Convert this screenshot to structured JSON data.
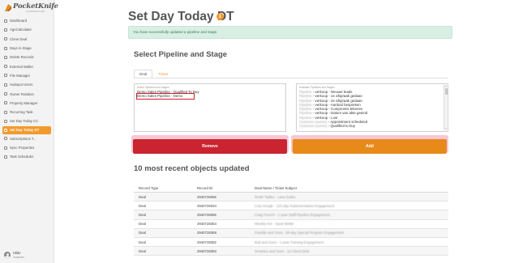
{
  "app": {
    "logo_text": "PocketKnife",
    "logo_subtext": "by CONTRAST ORG"
  },
  "sidebar": {
    "items": [
      {
        "label": "Dashboard",
        "icon": "dashboard-icon"
      },
      {
        "label": "AgeCalculator",
        "icon": "calculator-icon"
      },
      {
        "label": "Clone Deal",
        "icon": "clone-icon"
      },
      {
        "label": "Days in Stage",
        "icon": "calendar-icon"
      },
      {
        "label": "Delete Records",
        "icon": "trash-icon"
      },
      {
        "label": "External Wallet",
        "icon": "wallet-icon"
      },
      {
        "label": "File Manager",
        "icon": "folder-icon"
      },
      {
        "label": "Hubspot Users",
        "icon": "users-icon"
      },
      {
        "label": "Owner Rotation",
        "icon": "rotation-icon"
      },
      {
        "label": "Property Manager",
        "icon": "property-icon"
      },
      {
        "label": "Recurring Task",
        "icon": "recurring-icon"
      },
      {
        "label": "Set Day Today CC",
        "icon": "day-icon"
      },
      {
        "label": "Set Day Today DT",
        "icon": "day-icon"
      },
      {
        "label": "Subscriptions T...",
        "icon": "subscriptions-icon"
      },
      {
        "label": "Sync Properties",
        "icon": "sync-icon"
      },
      {
        "label": "Task Scheduler",
        "icon": "scheduler-icon"
      }
    ],
    "active_index": 12,
    "user": {
      "name": "Hilde",
      "role": "Customer"
    }
  },
  "page": {
    "title": "Set Day Today DT",
    "info_icon_glyph": "i",
    "alert": "You have successfully updated a pipeline and stage."
  },
  "picker": {
    "title": "Select Pipeline and Stage",
    "tabs": [
      {
        "label": "Deal",
        "active": true
      },
      {
        "label": "Ticket",
        "active": false
      }
    ],
    "active_caption": "Active Pipelines and Stages",
    "active_items": [
      "Demo Sales Pipeline - Qualified To Buy",
      "Demo Sales Pipeline - Demo"
    ],
    "active_selected_index": 1,
    "available_caption": "Available Pipelines and Stages",
    "available_items": [
      "Pipeline - verkoop - Nieuwe leads",
      "Pipeline - verkoop - 1e afspraak gedaan",
      "Pipeline - verkoop - 2e afspraak gedaan",
      "Pipeline - verkoop - Aanbod bespreken",
      "Pipeline - verkoop - Compromis tekenen",
      "Pipeline - verkoop - Datum van akte geeind",
      "Pipeline - verkoop - Lost",
      "Customer journey - Appointment scheduled",
      "Customer journey - Qualified to buy"
    ],
    "remove_label": "Remove",
    "add_label": "Add"
  },
  "recent": {
    "title": "10 most recent objects updated",
    "columns": [
      "Record Type",
      "Record ID",
      "Deal Name / Ticket Subject"
    ],
    "rows": [
      [
        "Deal",
        "2940728356",
        "Smith Tadiko - Lane Dubio"
      ],
      [
        "Deal",
        "2940728334",
        "Cory Dough - 120-day Implementation Engagement"
      ],
      [
        "Deal",
        "2940728355",
        "Craig French - 1-year Staff Pipeline Engagement"
      ],
      [
        "Deal",
        "2940728354",
        "Weekly irvii - Spott Binkle"
      ],
      [
        "Deal",
        "2940728369",
        "Franklin and Sons - 90-day Special Program Engagement"
      ],
      [
        "Deal",
        "2940728382",
        "Bob and Sons - 1-year Training Engagement"
      ],
      [
        "Deal",
        "2940728383",
        "Smarties and Sons - 12-Client Deal"
      ]
    ]
  },
  "colors": {
    "accent": "#f29a2e",
    "remove": "#c9242f",
    "add": "#e88a1a",
    "alert_bg": "#d9efe4",
    "alert_text": "#3f7a5a"
  }
}
